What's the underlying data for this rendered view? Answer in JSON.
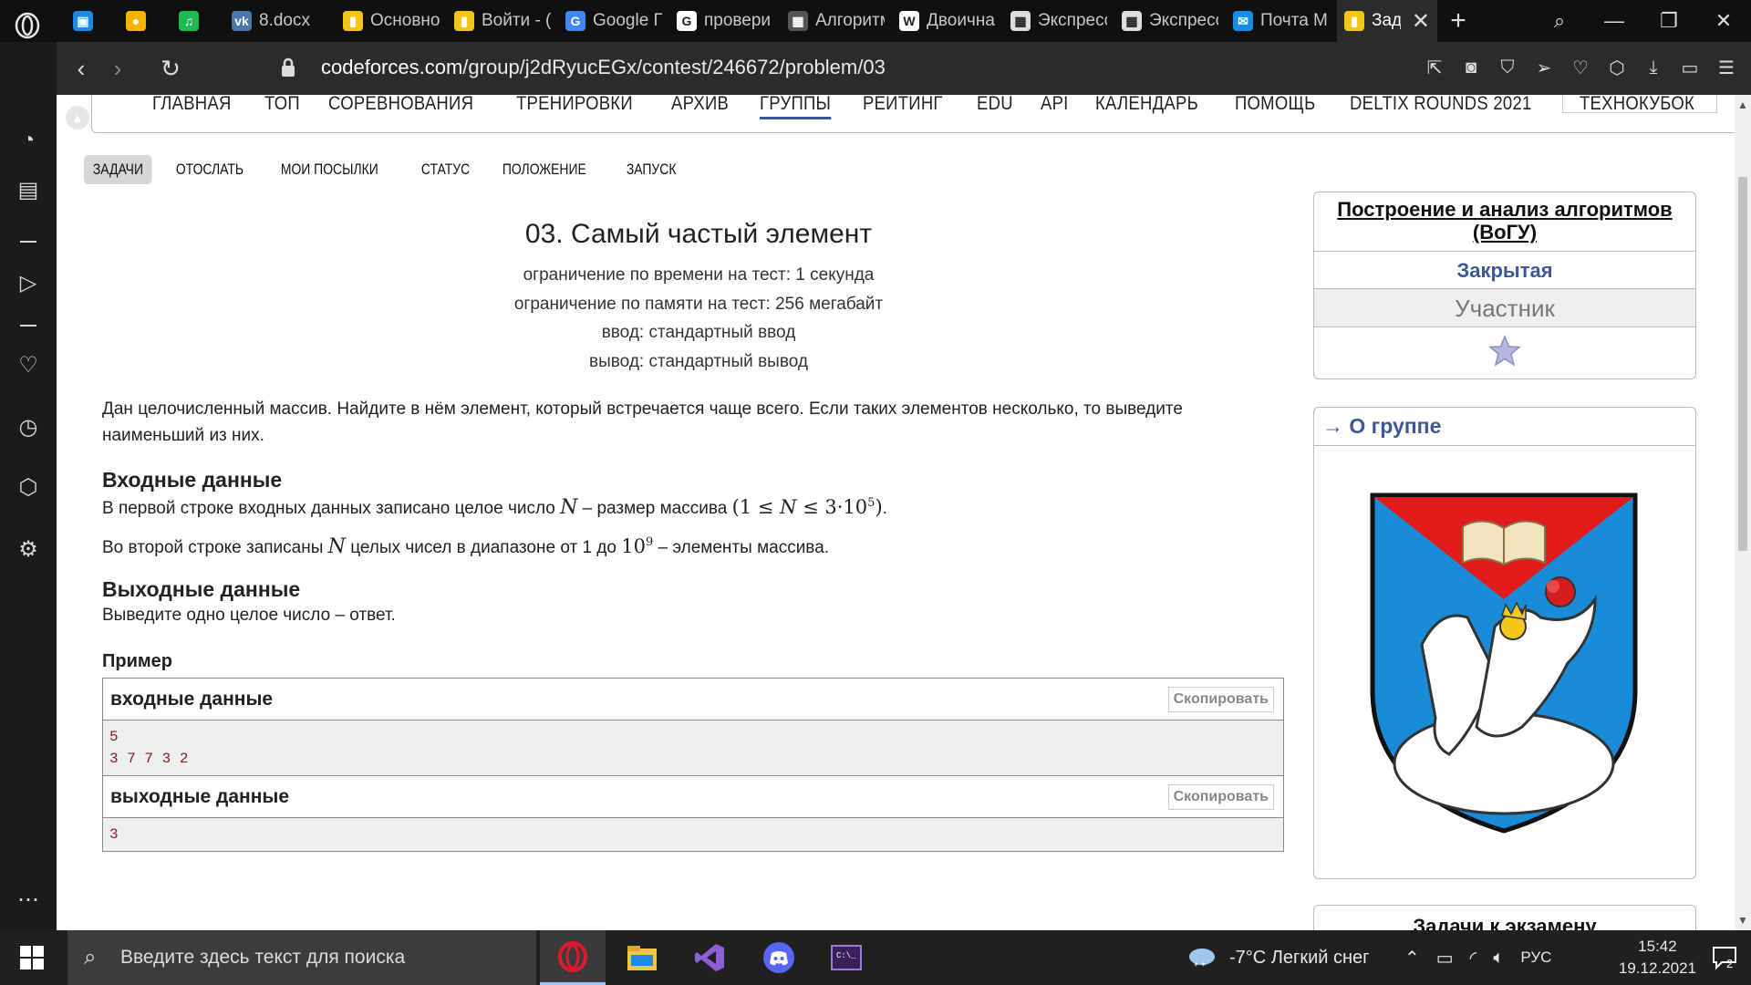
{
  "browser": {
    "tabs": [
      {
        "label": "",
        "icon": "chat-icon",
        "color": "#1e88e5"
      },
      {
        "label": "",
        "icon": "keep-icon",
        "color": "#f6b400"
      },
      {
        "label": "",
        "icon": "spotify-icon",
        "color": "#1db954"
      },
      {
        "label": "8.docx",
        "icon": "vk-icon",
        "color": "#4a76a8"
      },
      {
        "label": "Основно",
        "icon": "codeforces-icon",
        "color": "#f5c518"
      },
      {
        "label": "Войти - (",
        "icon": "codeforces-icon",
        "color": "#f5c518"
      },
      {
        "label": "Google П",
        "icon": "translate-icon",
        "color": "#4285f4"
      },
      {
        "label": "провери",
        "icon": "google-icon",
        "color": "#ffffff"
      },
      {
        "label": "Алгоритм",
        "icon": "algo-icon",
        "color": "#555555"
      },
      {
        "label": "Двоична",
        "icon": "wikipedia-icon",
        "color": "#ffffff"
      },
      {
        "label": "Экспресс",
        "icon": "speeddial-icon",
        "color": "#dddddd"
      },
      {
        "label": "Экспресс",
        "icon": "speeddial-icon",
        "color": "#dddddd"
      },
      {
        "label": "Почта М",
        "icon": "mail-icon",
        "color": "#168de2"
      }
    ],
    "active_tab": {
      "label": "Задач",
      "icon": "codeforces-icon"
    },
    "url_host": "codeforces.com",
    "url_path": "/group/j2dRyucEGx/contest/246672/problem/03"
  },
  "menu": {
    "items": [
      "ГЛАВНАЯ",
      "ТОП",
      "СОРЕВНОВАНИЯ",
      "ТРЕНИРОВКИ",
      "АРХИВ",
      "ГРУППЫ",
      "РЕЙТИНГ",
      "EDU",
      "API",
      "КАЛЕНДАРЬ",
      "ПОМОЩЬ",
      "DELTIX ROUNDS 2021",
      "ТЕХНОКУБОК"
    ],
    "active": "ГРУППЫ"
  },
  "second_menu": {
    "items": [
      "ЗАДАЧИ",
      "ОТОСЛАТЬ",
      "МОИ ПОСЫЛКИ",
      "СТАТУС",
      "ПОЛОЖЕНИЕ",
      "ЗАПУСК"
    ],
    "selected": "ЗАДАЧИ"
  },
  "problem": {
    "title": "03. Самый частый элемент",
    "time_limit": "ограничение по времени на тест: 1 секунда",
    "memory_limit": "ограничение по памяти на тест: 256 мегабайт",
    "input": "ввод: стандартный ввод",
    "output": "вывод: стандартный вывод",
    "legend": "Дан целочисленный массив. Найдите в нём элемент, который встречается чаще всего. Если таких элементов несколько, то выведите наименьший из них.",
    "input_title": "Входные данные",
    "input_text_1a": "В первой строке входных данных записано целое число ",
    "input_text_1b": " – размер массива ",
    "input_text_2a": "Во второй строке записаны ",
    "input_text_2b": " целых чисел в диапазоне от 1 до ",
    "input_text_2c": " – элементы массива.",
    "output_title": "Выходные данные",
    "output_text": "Выведите одно целое число – ответ.",
    "example_title": "Пример",
    "example_input_label": "входные данные",
    "example_output_label": "выходные данные",
    "copy_label": "Скопировать",
    "example_input": "5\n3 7 7 3 2",
    "example_output": "3"
  },
  "sidebar_right": {
    "group_title": "Построение и анализ алгоритмов (ВоГУ)",
    "status": "Закрытая",
    "role": "Участник",
    "about": "→ О группе",
    "next_box": "Задачи к экзамену"
  },
  "taskbar": {
    "search_placeholder": "Введите здесь текст для поиска",
    "weather": "-7°C  Легкий снег",
    "lang": "РУС",
    "time": "15:42",
    "date": "19.12.2021",
    "notif_count": "2"
  }
}
